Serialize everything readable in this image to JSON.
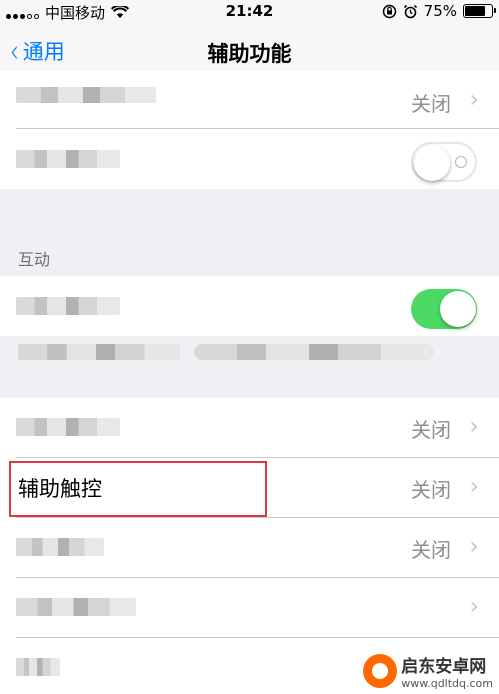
{
  "status": {
    "carrier": "中国移动",
    "time": "21:42",
    "battery_percent": "75%",
    "battery_level": 0.75
  },
  "nav": {
    "back_label": "通用",
    "title": "辅助功能"
  },
  "rows": {
    "reduce_motion_value": "关闭",
    "assistive_touch_label": "辅助触控",
    "assistive_touch_value": "关闭",
    "row_a_value": "关闭",
    "row_b_value": "关闭"
  },
  "section": {
    "interaction_header": "互动"
  },
  "toggles": {
    "first_on": false,
    "second_on": true
  },
  "watermark": {
    "name": "启东安卓网",
    "url": "www.qdltdq.com"
  },
  "colors": {
    "accent": "#007aff",
    "toggle_on": "#4cd964",
    "highlight": "#d9363e"
  }
}
